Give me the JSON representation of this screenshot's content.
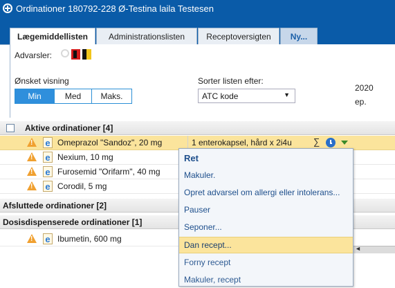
{
  "window": {
    "title": "Ordinationer 180792-228 Ø-Testina laila Testesen"
  },
  "tabs": [
    "Lægemiddellisten",
    "Administrationslisten",
    "Receptoversigten",
    "Ny..."
  ],
  "filters": {
    "warnings_label": "Advarsler:",
    "view_label": "Ønsket visning",
    "view_options": [
      "Min",
      "Med",
      "Maks."
    ],
    "view_selected": "Min",
    "sort_label": "Sorter listen efter:",
    "sort_value": "ATC kode",
    "right_fragments": [
      "2020",
      "ep."
    ]
  },
  "groups": {
    "active": "Aktive ordinationer [4]",
    "finished": "Afsluttede ordinationer [2]",
    "dispensed": "Dosisdispenserede ordinationer [1]"
  },
  "rows": {
    "active": [
      {
        "name": "Omeprazol \"Sandoz\", 20 mg",
        "dosage": "1 enterokapsel, hård x 2i4u",
        "selected": true
      },
      {
        "name": "Nexium, 10 mg"
      },
      {
        "name": "Furosemid \"Orifarm\", 40 mg"
      },
      {
        "name": "Corodil, 5 mg"
      }
    ],
    "dispensed": [
      {
        "name": "Ibumetin, 600 mg"
      }
    ]
  },
  "icons": {
    "sum": "∑",
    "warning": "warning-triangle-icon",
    "ie": "e"
  },
  "context_menu": {
    "items": [
      "Ret",
      "Makuler.",
      "Opret advarsel om allergi eller intolerans...",
      "Pauser",
      "Seponer...",
      "Dan recept...",
      "Forny recept",
      "Makuler, recept"
    ],
    "highlighted": "Dan recept..."
  },
  "colors": {
    "titlebar": "#0a5ba8",
    "selected_row": "#fbe49c",
    "segment_active": "#2f8fdc"
  }
}
